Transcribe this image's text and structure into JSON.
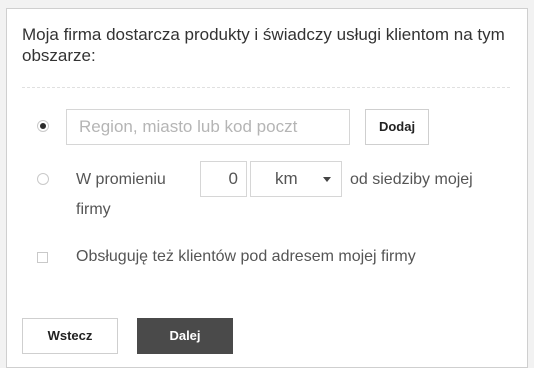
{
  "header": {
    "text": "Moja firma dostarcza produkty i świadczy usługi klientom na tym obszarze:"
  },
  "region_option": {
    "selected": true,
    "placeholder": "Region, miasto lub kod poczt",
    "add_label": "Dodaj"
  },
  "radius_option": {
    "selected": false,
    "prefix": "W promieniu",
    "value": "0",
    "unit": "km",
    "suffix_line1": "od siedziby mojej",
    "suffix_line2": "firmy"
  },
  "address_option": {
    "checked": false,
    "label": "Obsługuję też klientów pod adresem mojej firmy"
  },
  "footer": {
    "back_label": "Wstecz",
    "next_label": "Dalej"
  }
}
